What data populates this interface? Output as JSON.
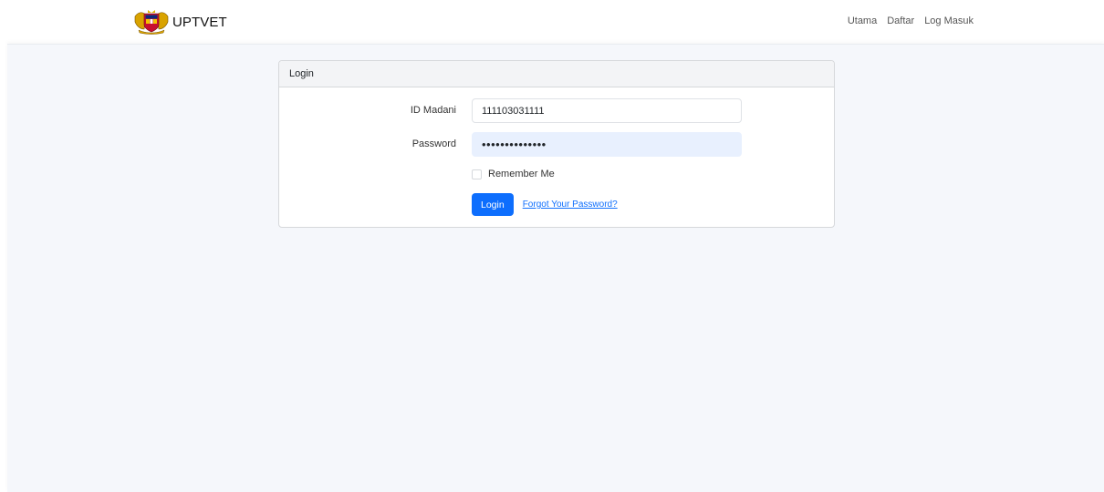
{
  "navbar": {
    "brand": "UPTVET",
    "links": [
      "Utama",
      "Daftar",
      "Log Masuk"
    ]
  },
  "login_card": {
    "header": "Login",
    "id_label": "ID Madani",
    "id_value": "111103031111",
    "password_label": "Password",
    "password_value": "••••••••••••••",
    "remember_label": "Remember Me",
    "login_button": "Login",
    "forgot_link": "Forgot Your Password?"
  },
  "colors": {
    "primary": "#0d6efd",
    "autofill": "#e8f0fe",
    "page_bg": "#f5f7fb"
  }
}
